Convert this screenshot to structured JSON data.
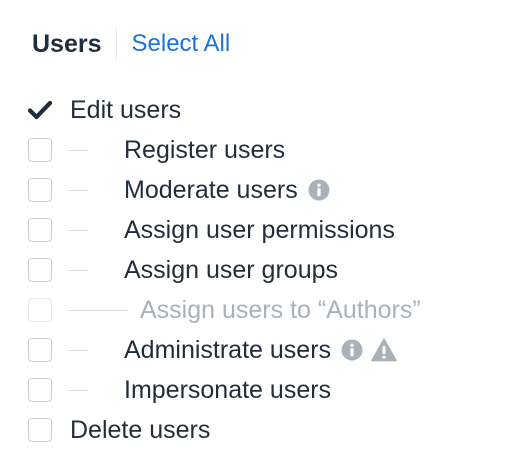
{
  "header": {
    "title": "Users",
    "select_all_label": "Select All"
  },
  "colors": {
    "link": "#1d72db",
    "text": "#1f2d3d",
    "icon_gray": "#a9b1ba",
    "disabled_text": "#a9b1ba"
  },
  "permissions": [
    {
      "label": "Edit users",
      "checked": true,
      "disabled": false,
      "level": 0,
      "icons": []
    },
    {
      "label": "Register users",
      "checked": false,
      "disabled": false,
      "level": 1,
      "icons": []
    },
    {
      "label": "Moderate users",
      "checked": false,
      "disabled": false,
      "level": 1,
      "icons": [
        "info-icon"
      ]
    },
    {
      "label": "Assign user permissions",
      "checked": false,
      "disabled": false,
      "level": 1,
      "icons": []
    },
    {
      "label": "Assign user groups",
      "checked": false,
      "disabled": false,
      "level": 1,
      "icons": []
    },
    {
      "label": "Assign users to “Authors”",
      "checked": false,
      "disabled": true,
      "level": 2,
      "icons": []
    },
    {
      "label": "Administrate users",
      "checked": false,
      "disabled": false,
      "level": 1,
      "icons": [
        "info-icon",
        "warning-icon"
      ]
    },
    {
      "label": "Impersonate users",
      "checked": false,
      "disabled": false,
      "level": 1,
      "icons": []
    },
    {
      "label": "Delete users",
      "checked": false,
      "disabled": false,
      "level": 0,
      "icons": []
    }
  ]
}
